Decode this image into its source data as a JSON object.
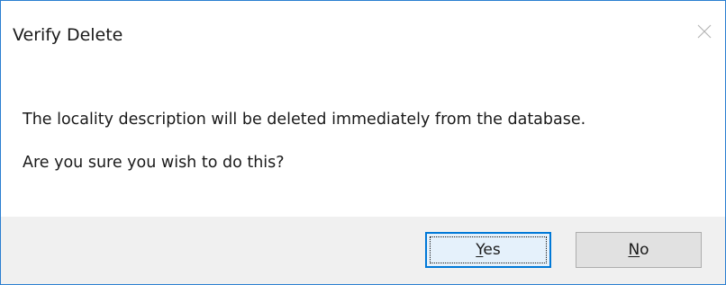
{
  "dialog": {
    "title": "Verify Delete",
    "close_icon": "close-icon",
    "message_line1": "The locality description will be deleted immediately from the database.",
    "message_line2": "Are you sure you wish to do this?"
  },
  "buttons": {
    "yes": {
      "accel": "Y",
      "rest": "es",
      "focused": true
    },
    "no": {
      "accel": "N",
      "rest": "o",
      "focused": false
    }
  },
  "colors": {
    "window_border": "#2b7fd1",
    "footer_background": "#f0f0f0",
    "default_button_border": "#0078d7",
    "button_background": "#e1e1e1"
  }
}
